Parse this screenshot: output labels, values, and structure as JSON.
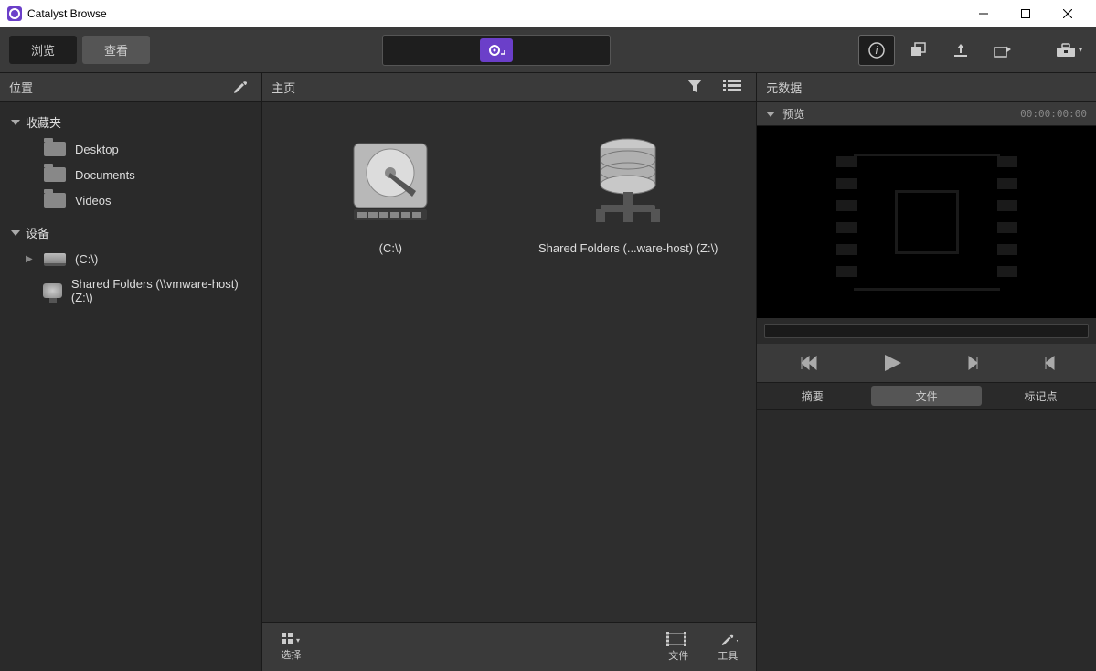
{
  "app": {
    "title": "Catalyst Browse"
  },
  "tabs": {
    "browse": "浏览",
    "view": "查看"
  },
  "sidebar": {
    "header": "位置",
    "favorites": {
      "label": "收藏夹",
      "items": [
        "Desktop",
        "Documents",
        "Videos"
      ]
    },
    "devices": {
      "label": "设备",
      "items": [
        "(C:\\)",
        "Shared Folders (\\\\vmware-host) (Z:\\)"
      ]
    }
  },
  "center": {
    "header": "主页",
    "items": [
      {
        "label": "(C:\\)"
      },
      {
        "label": "Shared Folders (...ware-host) (Z:\\)"
      }
    ],
    "footer": {
      "select": "选择",
      "file": "文件",
      "tools": "工具"
    }
  },
  "right": {
    "metadata": "元数据",
    "preview": "预览",
    "timecode": "00:00:00:00",
    "tabs": {
      "summary": "摘要",
      "file": "文件",
      "mark": "标记点"
    }
  }
}
